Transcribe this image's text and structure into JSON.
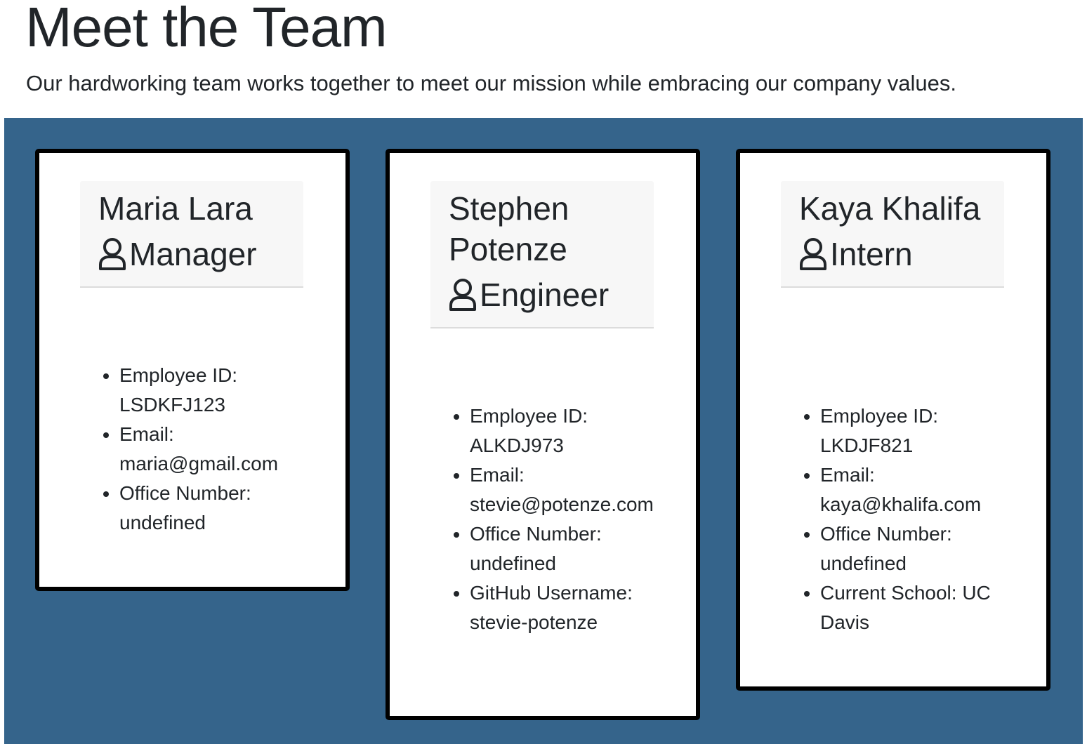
{
  "header": {
    "title": "Meet the Team",
    "subtitle": "Our hardworking team works together to meet our mission while embracing our company values."
  },
  "colors": {
    "panel_background": "#35648b",
    "card_border": "#000000",
    "card_header_background": "#f7f7f7"
  },
  "icons": {
    "role": "user-icon"
  },
  "team": [
    {
      "name": "Maria Lara",
      "role": "Manager",
      "details": [
        "Employee ID: LSDKFJ123",
        "Email: maria@gmail.com",
        "Office Number: undefined"
      ]
    },
    {
      "name": "Stephen Potenze",
      "role": "Engineer",
      "details": [
        "Employee ID: ALKDJ973",
        "Email: stevie@potenze.com",
        "Office Number: undefined",
        "GitHub Username: stevie-potenze"
      ]
    },
    {
      "name": "Kaya Khalifa",
      "role": "Intern",
      "details": [
        "Employee ID: LKDJF821",
        "Email: kaya@khalifa.com",
        "Office Number: undefined",
        "Current School: UC Davis"
      ]
    }
  ]
}
